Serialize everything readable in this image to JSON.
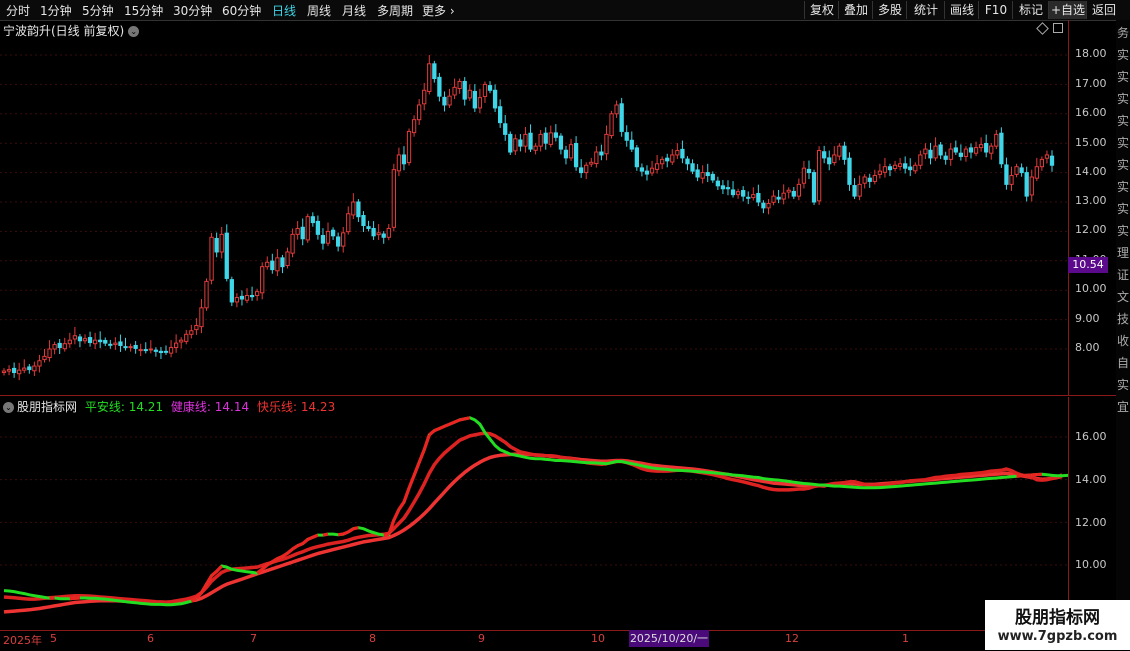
{
  "toolbar": {
    "periods": [
      "分时",
      "1分钟",
      "5分钟",
      "15分钟",
      "30分钟",
      "60分钟",
      "日线",
      "周线",
      "月线",
      "多周期",
      "更多 ›"
    ],
    "active_period": "日线",
    "buttons": [
      "复权",
      "叠加",
      "多股",
      "统计",
      "画线",
      "F10",
      "标记",
      "+自选",
      "返回"
    ]
  },
  "stock": {
    "title": "宁波韵升(日线 前复权)"
  },
  "price_axis": {
    "labels": [
      "18.00",
      "17.00",
      "16.00",
      "15.00",
      "14.00",
      "13.00",
      "12.00",
      "11.00",
      "10.00",
      "9.00",
      "8.00"
    ],
    "current_tag": "10.54"
  },
  "indicator": {
    "name": "股朋指标网",
    "lines": [
      {
        "label": "平安线:",
        "value": "14.21",
        "color": "#22dd22"
      },
      {
        "label": "健康线:",
        "value": "14.14",
        "color": "#dd33dd"
      },
      {
        "label": "快乐线:",
        "value": "14.23",
        "color": "#ee3333"
      }
    ],
    "axis_labels": [
      "16.00",
      "14.00",
      "12.00",
      "10.00"
    ]
  },
  "date_axis": {
    "labels": [
      "2025年",
      "5",
      "6",
      "7",
      "8",
      "9",
      "10",
      "12",
      "1"
    ],
    "highlight": "2025/10/20/一"
  },
  "right_strip": [
    "务",
    "实",
    "实",
    "实",
    "实",
    "实",
    "实",
    "实",
    "实",
    "实",
    "理",
    "证",
    "文",
    "技",
    "收",
    "自",
    "实",
    "宜"
  ],
  "watermark": {
    "title": "股朋指标网",
    "url": "www.7gpzb.com"
  },
  "chart_data": [
    {
      "type": "candlestick",
      "title": "宁波韵升(日线 前复权)",
      "ylim": [
        7.0,
        18.5
      ],
      "up_color": "#e23b3b",
      "down_color": "#3fd6e8",
      "closes": [
        7.25,
        7.3,
        7.2,
        7.28,
        7.35,
        7.3,
        7.42,
        7.6,
        7.75,
        8.0,
        8.15,
        8.05,
        8.18,
        8.3,
        8.45,
        8.28,
        8.35,
        8.22,
        8.3,
        8.25,
        8.2,
        8.15,
        8.2,
        8.12,
        8.05,
        8.08,
        8.02,
        7.98,
        7.95,
        8.0,
        7.92,
        7.88,
        7.9,
        8.05,
        8.2,
        8.3,
        8.5,
        8.62,
        8.8,
        9.4,
        10.3,
        11.8,
        11.3,
        11.9,
        10.4,
        9.6,
        9.75,
        9.7,
        9.82,
        9.78,
        9.95,
        10.8,
        10.95,
        10.7,
        11.1,
        10.8,
        11.3,
        11.9,
        12.1,
        11.75,
        12.5,
        12.3,
        11.9,
        11.6,
        12.0,
        11.85,
        11.5,
        11.95,
        12.6,
        13.0,
        12.5,
        12.2,
        12.1,
        11.85,
        11.95,
        11.8,
        12.1,
        14.1,
        14.6,
        14.3,
        15.4,
        15.8,
        16.3,
        16.8,
        17.7,
        17.2,
        16.6,
        16.3,
        16.6,
        16.9,
        17.1,
        16.5,
        16.8,
        16.2,
        16.55,
        17.0,
        16.8,
        16.2,
        15.7,
        15.3,
        14.7,
        15.15,
        14.9,
        15.3,
        14.8,
        14.9,
        15.3,
        15.0,
        15.35,
        15.2,
        14.8,
        14.5,
        14.95,
        14.2,
        14.0,
        14.25,
        14.35,
        14.7,
        14.6,
        15.3,
        16.0,
        16.3,
        15.4,
        15.1,
        14.8,
        14.2,
        14.05,
        13.95,
        14.15,
        14.3,
        14.45,
        14.4,
        14.6,
        14.75,
        14.5,
        14.3,
        14.05,
        13.85,
        14.0,
        13.9,
        13.75,
        13.55,
        13.45,
        13.45,
        13.25,
        13.35,
        13.2,
        13.15,
        13.25,
        13.0,
        12.8,
        12.95,
        13.2,
        13.1,
        13.3,
        13.4,
        13.2,
        13.6,
        14.15,
        14.0,
        13.0,
        14.75,
        14.5,
        14.3,
        14.6,
        14.9,
        14.45,
        13.6,
        13.2,
        13.6,
        13.85,
        13.7,
        13.9,
        14.05,
        14.2,
        14.1,
        14.25,
        14.3,
        14.15,
        14.1,
        14.25,
        14.6,
        14.8,
        14.5,
        14.9,
        14.6,
        14.45,
        14.8,
        14.7,
        14.55,
        14.8,
        14.7,
        14.85,
        14.95,
        14.7,
        14.9,
        15.3,
        14.3,
        13.6,
        13.9,
        14.2,
        14.0,
        13.2,
        13.85,
        14.2,
        14.45,
        14.6,
        14.25
      ]
    },
    {
      "type": "line",
      "title": "股朋指标网",
      "ylim": [
        8.8,
        17.5
      ],
      "series": [
        {
          "name": "平安线",
          "color": "#22dd22",
          "values": [
            8.8,
            8.78,
            8.75,
            8.7,
            8.66,
            8.6,
            8.56,
            8.52,
            8.48,
            8.44,
            8.45,
            8.42,
            8.42,
            8.42,
            8.44,
            8.45,
            8.45,
            8.44,
            8.44,
            8.42,
            8.4,
            8.37,
            8.34,
            8.31,
            8.28,
            8.25,
            8.23,
            8.2,
            8.18,
            8.16,
            8.15,
            8.15,
            8.14,
            8.14,
            8.16,
            8.18,
            8.24,
            8.3,
            8.43,
            8.7,
            9.1,
            9.5,
            9.7,
            9.95,
            9.9,
            9.8,
            9.75,
            9.72,
            9.68,
            9.65,
            9.62,
            9.8,
            10.0,
            10.15,
            10.3,
            10.4,
            10.55,
            10.75,
            10.9,
            11.0,
            11.2,
            11.3,
            11.4,
            11.4,
            11.45,
            11.45,
            11.42,
            11.45,
            11.55,
            11.7,
            11.75,
            11.7,
            11.6,
            11.52,
            11.45,
            11.4,
            11.42,
            12.1,
            12.6,
            12.95,
            13.6,
            14.2,
            14.8,
            15.4,
            16.1,
            16.3,
            16.4,
            16.5,
            16.6,
            16.7,
            16.8,
            16.85,
            16.9,
            16.8,
            16.6,
            16.2,
            15.9,
            15.6,
            15.4,
            15.3,
            15.2,
            15.15,
            15.1,
            15.05,
            15.0,
            14.98,
            14.98,
            14.95,
            14.93,
            14.9,
            14.9,
            14.88,
            14.86,
            14.84,
            14.82,
            14.8,
            14.79,
            14.78,
            14.77,
            14.75,
            14.8,
            14.85,
            14.85,
            14.8,
            14.75,
            14.7,
            14.65,
            14.6,
            14.55,
            14.52,
            14.5,
            14.48,
            14.45,
            14.44,
            14.43,
            14.42,
            14.4,
            14.38,
            14.36,
            14.34,
            14.32,
            14.3,
            14.28,
            14.25,
            14.22,
            14.2,
            14.18,
            14.15,
            14.12,
            14.1,
            14.05,
            14.02,
            14.0,
            13.98,
            13.95,
            13.92,
            13.88,
            13.85,
            13.82,
            13.8,
            13.78,
            13.75,
            13.75,
            13.72,
            13.7,
            13.7,
            13.68,
            13.66,
            13.64,
            13.63,
            13.62,
            13.62,
            13.62,
            13.63,
            13.64,
            13.66,
            13.68,
            13.7,
            13.72,
            13.74,
            13.76,
            13.78,
            13.8,
            13.82,
            13.84,
            13.86,
            13.88,
            13.9,
            13.92,
            13.94,
            13.96,
            13.98,
            14.0,
            14.02,
            14.04,
            14.06,
            14.08,
            14.1,
            14.12,
            14.14,
            14.16,
            14.18,
            14.2,
            14.22,
            14.24,
            14.25,
            14.23,
            14.2,
            14.18,
            14.18,
            14.2,
            14.21
          ]
        },
        {
          "name": "健康线",
          "color": "#dd33dd",
          "values": [
            8.5,
            8.48,
            8.46,
            8.44,
            8.42,
            8.4,
            8.4,
            8.42,
            8.44,
            8.46,
            8.48,
            8.5,
            8.52,
            8.54,
            8.56,
            8.56,
            8.55,
            8.54,
            8.52,
            8.5,
            8.48,
            8.46,
            8.44,
            8.42,
            8.4,
            8.38,
            8.36,
            8.34,
            8.32,
            8.3,
            8.28,
            8.27,
            8.26,
            8.28,
            8.32,
            8.36,
            8.4,
            8.46,
            8.54,
            8.7,
            8.95,
            9.25,
            9.45,
            9.65,
            9.75,
            9.8,
            9.82,
            9.84,
            9.86,
            9.88,
            9.9,
            9.98,
            10.06,
            10.12,
            10.2,
            10.26,
            10.34,
            10.44,
            10.54,
            10.62,
            10.72,
            10.8,
            10.86,
            10.92,
            10.98,
            11.02,
            11.06,
            11.1,
            11.16,
            11.24,
            11.3,
            11.34,
            11.38,
            11.4,
            11.42,
            11.44,
            11.48,
            11.7,
            11.95,
            12.2,
            12.55,
            12.95,
            13.35,
            13.8,
            14.3,
            14.7,
            15.0,
            15.25,
            15.45,
            15.65,
            15.85,
            15.95,
            16.05,
            16.1,
            16.15,
            16.18,
            16.15,
            16.05,
            15.9,
            15.75,
            15.55,
            15.42,
            15.3,
            15.25,
            15.2,
            15.15,
            15.15,
            15.12,
            15.12,
            15.1,
            15.05,
            15.0,
            14.98,
            14.92,
            14.85,
            14.8,
            14.76,
            14.75,
            14.72,
            14.75,
            14.8,
            14.85,
            14.85,
            14.8,
            14.72,
            14.62,
            14.52,
            14.45,
            14.42,
            14.4,
            14.4,
            14.4,
            14.42,
            14.44,
            14.44,
            14.42,
            14.4,
            14.36,
            14.32,
            14.28,
            14.24,
            14.18,
            14.12,
            14.05,
            14.0,
            13.95,
            13.9,
            13.84,
            13.78,
            13.72,
            13.64,
            13.58,
            13.54,
            13.52,
            13.52,
            13.52,
            13.54,
            13.56,
            13.56,
            13.6,
            13.68,
            13.72,
            13.7,
            13.78,
            13.82,
            13.84,
            13.86,
            13.9,
            13.9,
            13.84,
            13.78,
            13.74,
            13.74,
            13.74,
            13.76,
            13.8,
            13.84,
            13.86,
            13.9,
            13.94,
            13.96,
            13.98,
            14.0,
            14.05,
            14.1,
            14.12,
            14.16,
            14.18,
            14.2,
            14.24,
            14.26,
            14.28,
            14.3,
            14.32,
            14.36,
            14.4,
            14.42,
            14.44,
            14.5,
            14.42,
            14.3,
            14.22,
            14.18,
            14.12,
            14.0,
            13.98,
            14.0,
            14.05,
            14.1,
            14.14
          ]
        },
        {
          "name": "快乐线",
          "color": "#ee3333",
          "values": [
            7.8,
            7.82,
            7.84,
            7.86,
            7.88,
            7.9,
            7.93,
            7.96,
            8.0,
            8.04,
            8.08,
            8.12,
            8.16,
            8.2,
            8.24,
            8.26,
            8.28,
            8.3,
            8.31,
            8.32,
            8.32,
            8.32,
            8.32,
            8.31,
            8.3,
            8.29,
            8.28,
            8.27,
            8.26,
            8.25,
            8.24,
            8.23,
            8.22,
            8.23,
            8.24,
            8.26,
            8.28,
            8.32,
            8.36,
            8.44,
            8.56,
            8.7,
            8.84,
            8.98,
            9.1,
            9.18,
            9.26,
            9.34,
            9.42,
            9.5,
            9.58,
            9.66,
            9.74,
            9.82,
            9.9,
            9.98,
            10.06,
            10.14,
            10.22,
            10.3,
            10.38,
            10.46,
            10.54,
            10.6,
            10.66,
            10.72,
            10.78,
            10.84,
            10.9,
            10.96,
            11.02,
            11.08,
            11.12,
            11.16,
            11.2,
            11.24,
            11.28,
            11.38,
            11.5,
            11.64,
            11.8,
            11.98,
            12.18,
            12.4,
            12.64,
            12.9,
            13.16,
            13.42,
            13.68,
            13.92,
            14.14,
            14.34,
            14.52,
            14.68,
            14.82,
            14.94,
            15.04,
            15.1,
            15.14,
            15.16,
            15.18,
            15.2,
            15.2,
            15.2,
            15.18,
            15.16,
            15.14,
            15.12,
            15.1,
            15.08,
            15.05,
            15.02,
            15.0,
            14.97,
            14.94,
            14.92,
            14.9,
            14.88,
            14.86,
            14.86,
            14.88,
            14.9,
            14.9,
            14.88,
            14.84,
            14.8,
            14.76,
            14.72,
            14.68,
            14.65,
            14.62,
            14.6,
            14.58,
            14.56,
            14.54,
            14.52,
            14.5,
            14.47,
            14.44,
            14.4,
            14.36,
            14.32,
            14.28,
            14.24,
            14.2,
            14.15,
            14.1,
            14.05,
            14.0,
            13.96,
            13.92,
            13.88,
            13.84,
            13.82,
            13.8,
            13.78,
            13.76,
            13.74,
            13.72,
            13.72,
            13.72,
            13.72,
            13.74,
            13.76,
            13.78,
            13.8,
            13.82,
            13.82,
            13.8,
            13.78,
            13.78,
            13.78,
            13.78,
            13.8,
            13.82,
            13.84,
            13.86,
            13.88,
            13.9,
            13.92,
            13.94,
            13.96,
            13.98,
            14.0,
            14.02,
            14.04,
            14.06,
            14.08,
            14.1,
            14.12,
            14.14,
            14.16,
            14.18,
            14.2,
            14.22,
            14.24,
            14.26,
            14.28,
            14.3,
            14.26,
            14.22,
            14.18,
            14.14,
            14.1,
            14.05,
            14.02,
            14.03,
            14.06,
            14.1,
            14.23
          ]
        }
      ]
    }
  ]
}
